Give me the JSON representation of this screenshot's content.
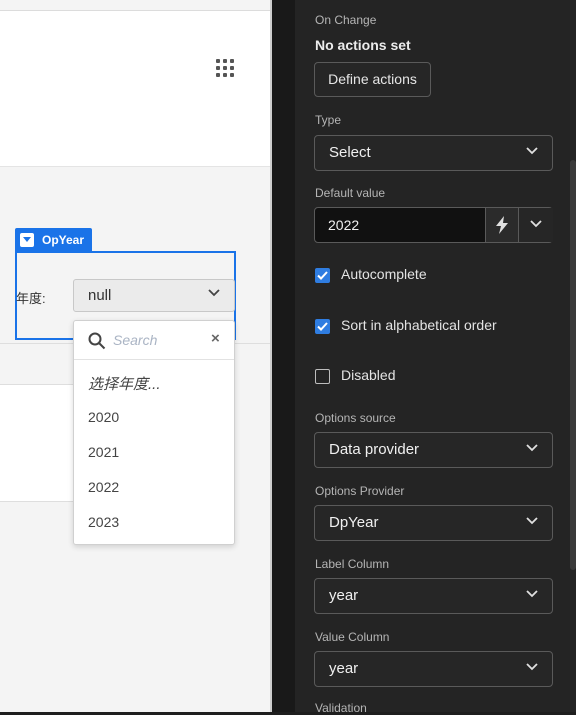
{
  "canvas": {
    "component_tag": "OpYear",
    "field_label": "年度:",
    "select_value": "null",
    "dropdown": {
      "search_placeholder": "Search",
      "items": [
        "选择年度...",
        "2020",
        "2021",
        "2022",
        "2023"
      ]
    }
  },
  "panel": {
    "on_change": {
      "label": "On Change",
      "status": "No actions set",
      "button": "Define actions"
    },
    "type": {
      "label": "Type",
      "value": "Select"
    },
    "default_value": {
      "label": "Default value",
      "value": "2022"
    },
    "autocomplete": {
      "label": "Autocomplete",
      "checked": true
    },
    "sort_alpha": {
      "label": "Sort in alphabetical order",
      "checked": true
    },
    "disabled": {
      "label": "Disabled",
      "checked": false
    },
    "options_source": {
      "label": "Options source",
      "value": "Data provider"
    },
    "options_provider": {
      "label": "Options Provider",
      "value": "DpYear"
    },
    "label_column": {
      "label": "Label Column",
      "value": "year"
    },
    "value_column": {
      "label": "Value Column",
      "value": "year"
    },
    "validation": {
      "label": "Validation"
    }
  },
  "colors": {
    "accent": "#1a73e8",
    "checkbox": "#2f7de1",
    "panel_bg": "#242424",
    "canvas_bg": "#f4f4f4"
  },
  "icons": [
    "grid-dots-icon",
    "chevron-down-icon",
    "search-icon",
    "close-icon",
    "lightning-icon",
    "check-icon"
  ]
}
